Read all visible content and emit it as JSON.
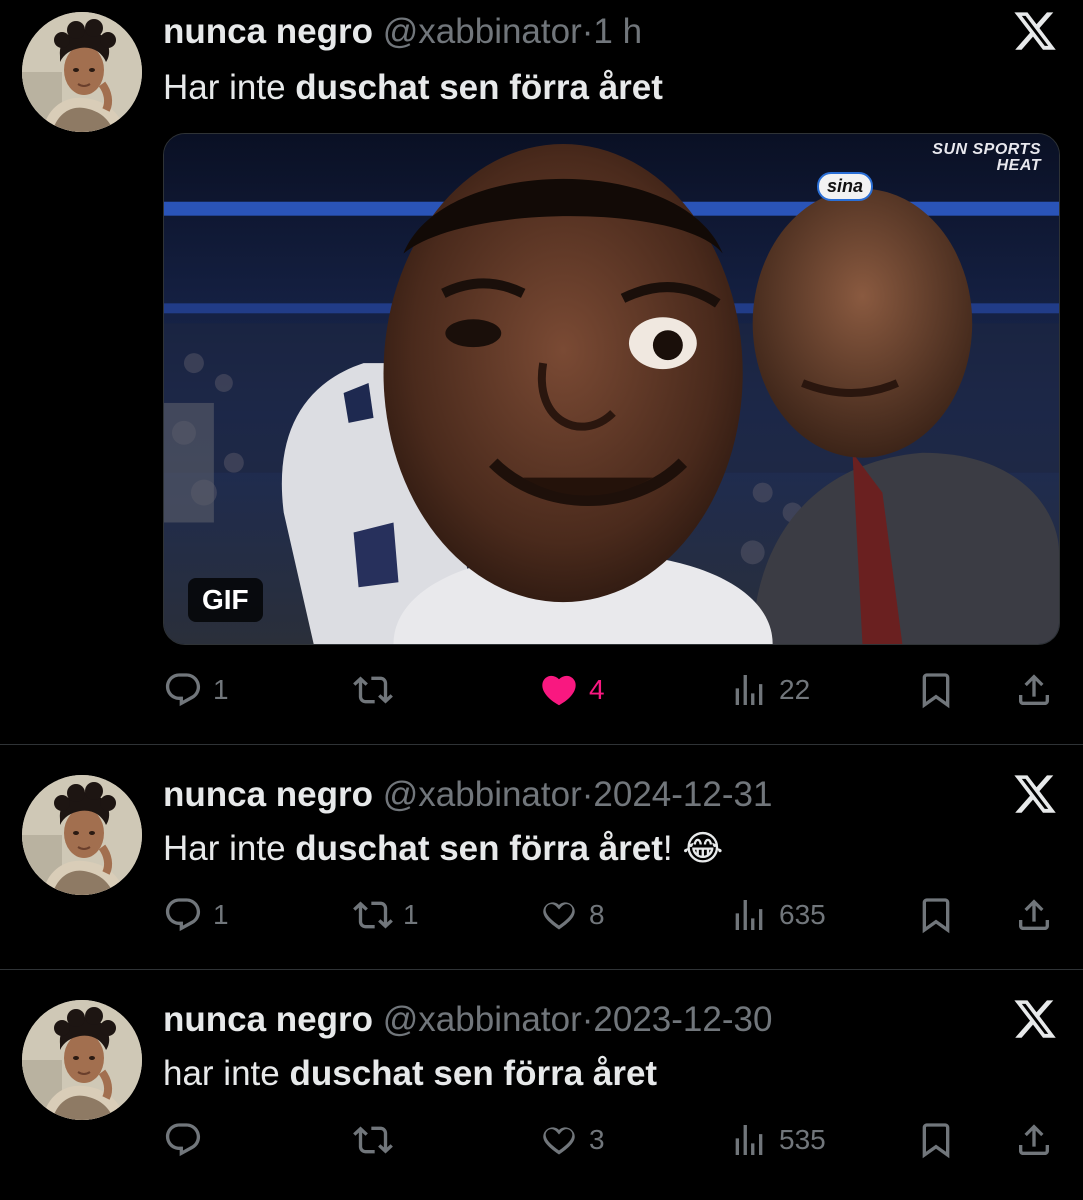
{
  "tweets": [
    {
      "name": "nunca negro",
      "handle": "@xabbinator",
      "sep": "·",
      "time": "1 h",
      "text_plain": "Har inte ",
      "text_bold": "duschat sen förra året",
      "text_tail": "",
      "media": {
        "badge": "GIF",
        "broadcast_line1": "SUN SPORTS",
        "broadcast_line2": "HEAT",
        "logo_text": "sina"
      },
      "replies": "1",
      "reposts": "",
      "likes": "4",
      "liked": true,
      "views": "22"
    },
    {
      "name": "nunca negro",
      "handle": "@xabbinator",
      "sep": "·",
      "time": "2024-12-31",
      "text_plain": "Har inte ",
      "text_bold": "duschat sen förra året",
      "text_tail": "! 😂",
      "replies": "1",
      "reposts": "1",
      "likes": "8",
      "liked": false,
      "views": "635"
    },
    {
      "name": "nunca negro",
      "handle": "@xabbinator",
      "sep": "·",
      "time": "2023-12-30",
      "text_plain": "har inte ",
      "text_bold": "duschat sen förra året",
      "text_tail": "",
      "replies": "",
      "reposts": "",
      "likes": "3",
      "liked": false,
      "views": "535"
    }
  ],
  "colors": {
    "like_active": "#f91880",
    "muted": "#71767b",
    "text": "#e7e9ea",
    "bg": "#000000"
  },
  "icons": [
    "reply-icon",
    "repost-icon",
    "like-icon",
    "views-icon",
    "bookmark-icon",
    "share-icon",
    "x-logo-icon"
  ]
}
